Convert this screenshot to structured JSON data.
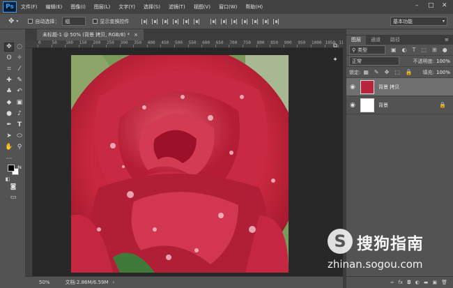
{
  "app": {
    "logo": "Ps"
  },
  "menu": [
    "文件(F)",
    "编辑(E)",
    "图像(I)",
    "图层(L)",
    "文字(Y)",
    "选择(S)",
    "滤镜(T)",
    "视图(V)",
    "窗口(W)",
    "帮助(H)"
  ],
  "window_controls": [
    "–",
    "□",
    "✕"
  ],
  "options": {
    "auto_select_label": "自动选择：",
    "auto_select_value": "组",
    "transform_label": "显示变换控件",
    "workspace": "基本功能"
  },
  "document": {
    "tab_title": "未标题-1 @ 50% (背景 拷贝, RGB/8) *",
    "close": "×"
  },
  "ruler_labels": [
    "0",
    "50",
    "100",
    "150",
    "200",
    "250",
    "300",
    "350",
    "400",
    "450",
    "500",
    "550",
    "600",
    "650",
    "700",
    "750",
    "800",
    "850",
    "900",
    "950",
    "1000",
    "1050",
    "1100"
  ],
  "status": {
    "zoom": "50%",
    "doc_info": "文档:2.86M/6.59M"
  },
  "layers_panel": {
    "tabs": [
      "图层",
      "通道",
      "路径"
    ],
    "filter_kind": "类型",
    "blend_mode": "正常",
    "opacity_label": "不透明度:",
    "opacity_value": "100%",
    "lock_label": "锁定:",
    "fill_label": "填充:",
    "fill_value": "100%",
    "layers": [
      {
        "name": "背景 拷贝",
        "selected": true
      },
      {
        "name": "背景",
        "selected": false,
        "locked": true
      }
    ],
    "bottom_icons": [
      "∞",
      "fx",
      "◘",
      "◐",
      "▬",
      "▣",
      "🗑"
    ]
  },
  "watermark": {
    "text": "搜狗指南",
    "url": "zhinan.sogou.com"
  },
  "colors": {
    "menubar": "#424242",
    "ui": "#535353",
    "canvas_bg": "#282828",
    "selection": "#6f6f6f"
  }
}
